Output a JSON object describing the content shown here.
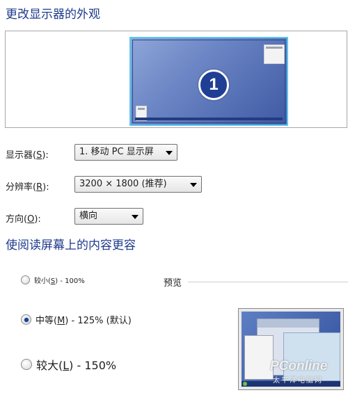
{
  "appearance": {
    "title": "更改显示器的外观",
    "monitor_number": "1"
  },
  "display": {
    "label_prefix": "显示器(",
    "label_key": "S",
    "label_suffix": "):",
    "value": "1. 移动 PC 显示屏"
  },
  "resolution": {
    "label_prefix": "分辨率(",
    "label_key": "R",
    "label_suffix": "):",
    "value": "3200 × 1800 (推荐)"
  },
  "orientation": {
    "label_prefix": "方向(",
    "label_key": "O",
    "label_suffix": "):",
    "value": "横向"
  },
  "text_size": {
    "title": "使阅读屏幕上的内容更容",
    "options": [
      {
        "label_prefix": "较小(",
        "key": "S",
        "label_suffix": ") - 100%",
        "checked": false
      },
      {
        "label_prefix": "中等(",
        "key": "M",
        "label_suffix": ") - 125% (默认)",
        "checked": true
      },
      {
        "label_prefix": "较大(",
        "key": "L",
        "label_suffix": ") - 150%",
        "checked": false
      }
    ],
    "preview_label": "预览"
  },
  "watermark": {
    "brand": "PConline",
    "sub": "太平洋电脑网"
  }
}
